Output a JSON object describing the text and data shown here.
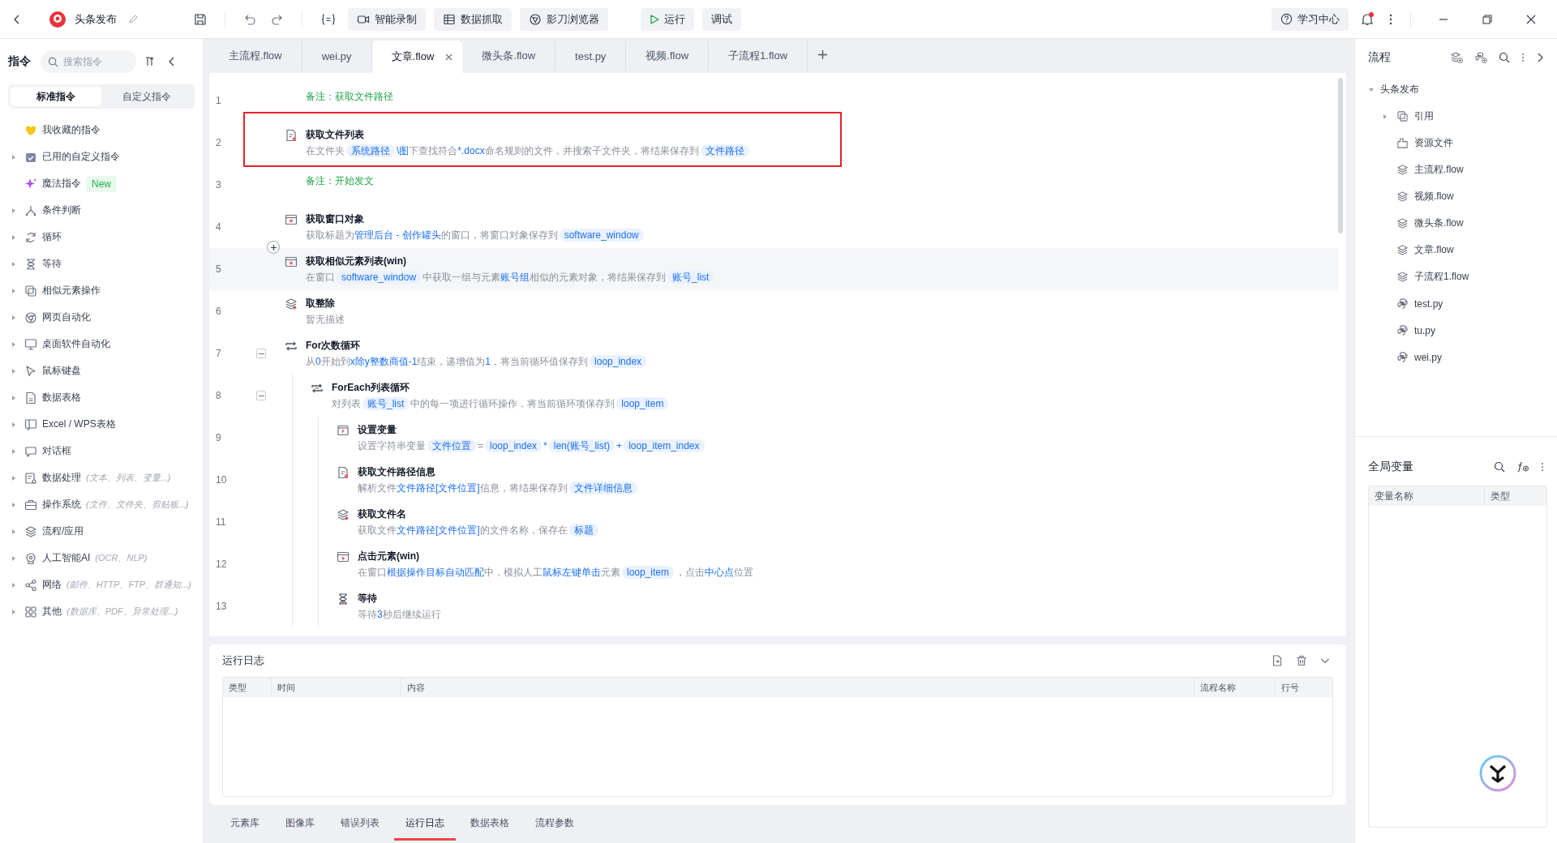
{
  "topbar": {
    "project": "头条发布",
    "tools": [
      {
        "kind": "record",
        "label": "智能录制"
      },
      {
        "kind": "table",
        "label": "数据抓取"
      },
      {
        "kind": "browser",
        "label": "影刀浏览器"
      }
    ],
    "run": "运行",
    "debug": "调试",
    "help": "学习中心",
    "notification": true
  },
  "sidebar": {
    "title": "指令",
    "search": {
      "placeholder": "搜索指令"
    },
    "tabs": [
      {
        "label": "标准指令",
        "selected": true
      },
      {
        "label": "自定义指令",
        "selected": false
      }
    ],
    "items": [
      {
        "kind": "heart",
        "label": "我收藏的指令",
        "expandable": false
      },
      {
        "kind": "calendar",
        "label": "已用的自定义指令",
        "expandable": true
      },
      {
        "kind": "sparkle",
        "label": "魔法指令",
        "expandable": false,
        "badge": "New"
      },
      {
        "kind": "branch",
        "label": "条件判断",
        "expandable": true
      },
      {
        "kind": "loop",
        "label": "循环",
        "expandable": true
      },
      {
        "kind": "hourglass",
        "label": "等待",
        "expandable": true
      },
      {
        "kind": "copy",
        "label": "相似元素操作",
        "expandable": true
      },
      {
        "kind": "globe",
        "label": "网页自动化",
        "expandable": true
      },
      {
        "kind": "monitor",
        "label": "桌面软件自动化",
        "expandable": true
      },
      {
        "kind": "cursor",
        "label": "鼠标键盘",
        "expandable": true
      },
      {
        "kind": "sheet",
        "label": "数据表格",
        "expandable": true
      },
      {
        "kind": "excel",
        "label": "Excel / WPS表格",
        "expandable": true
      },
      {
        "kind": "chat",
        "label": "对话框",
        "expandable": true
      },
      {
        "kind": "data",
        "label": "数据处理",
        "expandable": true,
        "hint": "(文本、列表、变量...)"
      },
      {
        "kind": "briefcase",
        "label": "操作系统",
        "expandable": true,
        "hint": "(文件、文件夹、剪贴板...)"
      },
      {
        "kind": "layers",
        "label": "流程/应用",
        "expandable": true
      },
      {
        "kind": "ai",
        "label": "人工智能AI",
        "expandable": true,
        "hint": "(OCR、NLP)"
      },
      {
        "kind": "share",
        "label": "网络",
        "expandable": true,
        "hint": "(邮件、HTTP、FTP、群通知...)"
      },
      {
        "kind": "grid",
        "label": "其他",
        "expandable": true,
        "hint": "(数据库、PDF、异常处理...)"
      }
    ]
  },
  "editor": {
    "tabs": [
      {
        "label": "主流程.flow",
        "selected": false
      },
      {
        "label": "wei.py",
        "selected": false
      },
      {
        "label": "文章.flow",
        "selected": true
      },
      {
        "label": "微头条.flow",
        "selected": false
      },
      {
        "label": "test.py",
        "selected": false
      },
      {
        "label": "视频.flow",
        "selected": false
      },
      {
        "label": "子流程1.flow",
        "selected": false
      }
    ],
    "steps": [
      {
        "line": "1",
        "kind": "comment",
        "text": "备注：获取文件路径"
      },
      {
        "line": "2",
        "kind": "file",
        "title": "获取文件列表",
        "highlighted": true,
        "desc": [
          {
            "kind": "text",
            "text": "在文件夹"
          },
          {
            "kind": "var",
            "text": "系统路径"
          },
          {
            "kind": "link",
            "text": "\\图"
          },
          {
            "kind": "text",
            "text": "下查找符合"
          },
          {
            "kind": "link",
            "text": "*.docx"
          },
          {
            "kind": "text",
            "text": "命名规则的文件，并搜索子文件夹，将结果保存到"
          },
          {
            "kind": "var",
            "text": "文件路径"
          }
        ]
      },
      {
        "line": "3",
        "kind": "comment",
        "text": "备注：开始发文"
      },
      {
        "line": "4",
        "kind": "window",
        "title": "获取窗口对象",
        "desc": [
          {
            "kind": "text",
            "text": "获取标题为"
          },
          {
            "kind": "link",
            "text": "管理后台 - 创作罐头"
          },
          {
            "kind": "text",
            "text": "的窗口，将窗口对象保存到"
          },
          {
            "kind": "var",
            "text": "software_window"
          }
        ]
      },
      {
        "line": "5",
        "kind": "window",
        "title": "获取相似元素列表(win)",
        "hovered": true,
        "desc": [
          {
            "kind": "text",
            "text": "在窗口"
          },
          {
            "kind": "var",
            "text": "software_window"
          },
          {
            "kind": "text",
            "text": "中获取一组与元素"
          },
          {
            "kind": "link",
            "text": "账号组"
          },
          {
            "kind": "text",
            "text": "相似的元素对象，将结果保存到"
          },
          {
            "kind": "var",
            "text": "账号_list"
          }
        ]
      },
      {
        "line": "6",
        "kind": "layers",
        "title": "取整除",
        "desc": [
          {
            "kind": "text",
            "text": "暂无描述"
          }
        ]
      },
      {
        "line": "7",
        "kind": "loop",
        "title": "For次数循环",
        "expanded": true,
        "desc": [
          {
            "kind": "text",
            "text": "从"
          },
          {
            "kind": "link",
            "text": "0"
          },
          {
            "kind": "text",
            "text": "开始到"
          },
          {
            "kind": "link",
            "text": "x除y整数商值-1"
          },
          {
            "kind": "text",
            "text": "结束，递增值为"
          },
          {
            "kind": "link",
            "text": "1"
          },
          {
            "kind": "text",
            "text": "，将当前循环值保存到"
          },
          {
            "kind": "var",
            "text": "loop_index"
          }
        ],
        "children": [
          {
            "line": "8",
            "kind": "foreach",
            "title": "ForEach列表循环",
            "expanded": true,
            "desc": [
              {
                "kind": "text",
                "text": "对列表"
              },
              {
                "kind": "var",
                "text": "账号_list"
              },
              {
                "kind": "text",
                "text": "中的每一项进行循环操作，将当前循环项保存到"
              },
              {
                "kind": "var",
                "text": "loop_item"
              }
            ],
            "children": [
              {
                "line": "9",
                "kind": "variable",
                "title": "设置变量",
                "desc": [
                  {
                    "kind": "text",
                    "text": "设置字符串变量"
                  },
                  {
                    "kind": "var",
                    "text": "文件位置"
                  },
                  {
                    "kind": "text",
                    "text": "="
                  },
                  {
                    "kind": "var",
                    "text": "loop_index"
                  },
                  {
                    "kind": "link",
                    "text": "*"
                  },
                  {
                    "kind": "var",
                    "text": "len(账号_list)"
                  },
                  {
                    "kind": "link",
                    "text": "+"
                  },
                  {
                    "kind": "var",
                    "text": "loop_item_index"
                  }
                ]
              },
              {
                "line": "10",
                "kind": "file",
                "title": "获取文件路径信息",
                "desc": [
                  {
                    "kind": "text",
                    "text": "解析文件"
                  },
                  {
                    "kind": "link",
                    "text": "文件路径[文件位置]"
                  },
                  {
                    "kind": "text",
                    "text": "信息，将结果保存到"
                  },
                  {
                    "kind": "var",
                    "text": "文件详细信息"
                  }
                ]
              },
              {
                "line": "11",
                "kind": "layers",
                "title": "获取文件名",
                "desc": [
                  {
                    "kind": "text",
                    "text": "获取文件"
                  },
                  {
                    "kind": "link",
                    "text": "文件路径[文件位置]"
                  },
                  {
                    "kind": "text",
                    "text": "的文件名称，保存在"
                  },
                  {
                    "kind": "var",
                    "text": "标题"
                  }
                ]
              },
              {
                "line": "12",
                "kind": "click",
                "title": "点击元素(win)",
                "desc": [
                  {
                    "kind": "text",
                    "text": "在窗口"
                  },
                  {
                    "kind": "link",
                    "text": "根据操作目标自动匹配"
                  },
                  {
                    "kind": "text",
                    "text": "中，模拟人工"
                  },
                  {
                    "kind": "link",
                    "text": "鼠标左键单击"
                  },
                  {
                    "kind": "text",
                    "text": "元素"
                  },
                  {
                    "kind": "var",
                    "text": "loop_item"
                  },
                  {
                    "kind": "text",
                    "text": "，点击"
                  },
                  {
                    "kind": "link",
                    "text": "中心点"
                  },
                  {
                    "kind": "text",
                    "text": "位置"
                  }
                ]
              },
              {
                "line": "13",
                "kind": "hourglass",
                "title": "等待",
                "desc": [
                  {
                    "kind": "text",
                    "text": "等待"
                  },
                  {
                    "kind": "link",
                    "text": "3"
                  },
                  {
                    "kind": "text",
                    "text": "秒后继续运行"
                  }
                ]
              }
            ]
          }
        ]
      }
    ]
  },
  "log": {
    "title": "运行日志",
    "columns": [
      "类型",
      "时间",
      "内容",
      "流程名称",
      "行号"
    ]
  },
  "bottom_tabs": [
    {
      "label": "元素库",
      "selected": false
    },
    {
      "label": "图像库",
      "selected": false
    },
    {
      "label": "错误列表",
      "selected": false
    },
    {
      "label": "运行日志",
      "selected": true
    },
    {
      "label": "数据表格",
      "selected": false
    },
    {
      "label": "流程参数",
      "selected": false
    }
  ],
  "flow_panel": {
    "title": "流程",
    "root": {
      "label": "头条发布",
      "expanded": true,
      "children": [
        {
          "kind": "ref",
          "label": "引用",
          "expandable": true
        },
        {
          "kind": "resource",
          "label": "资源文件",
          "expandable": false
        },
        {
          "kind": "flow",
          "label": "主流程.flow",
          "expandable": false
        },
        {
          "kind": "flow",
          "label": "视频.flow",
          "expandable": false
        },
        {
          "kind": "flow",
          "label": "微头条.flow",
          "expandable": false
        },
        {
          "kind": "flow",
          "label": "文章.flow",
          "expandable": false
        },
        {
          "kind": "flow",
          "label": "子流程1.flow",
          "expandable": false
        },
        {
          "kind": "python",
          "label": "test.py",
          "expandable": false
        },
        {
          "kind": "python",
          "label": "tu.py",
          "expandable": false
        },
        {
          "kind": "python",
          "label": "wei.py",
          "expandable": false
        }
      ]
    }
  },
  "variables_panel": {
    "title": "全局变量",
    "columns": [
      "变量名称",
      "类型"
    ]
  }
}
